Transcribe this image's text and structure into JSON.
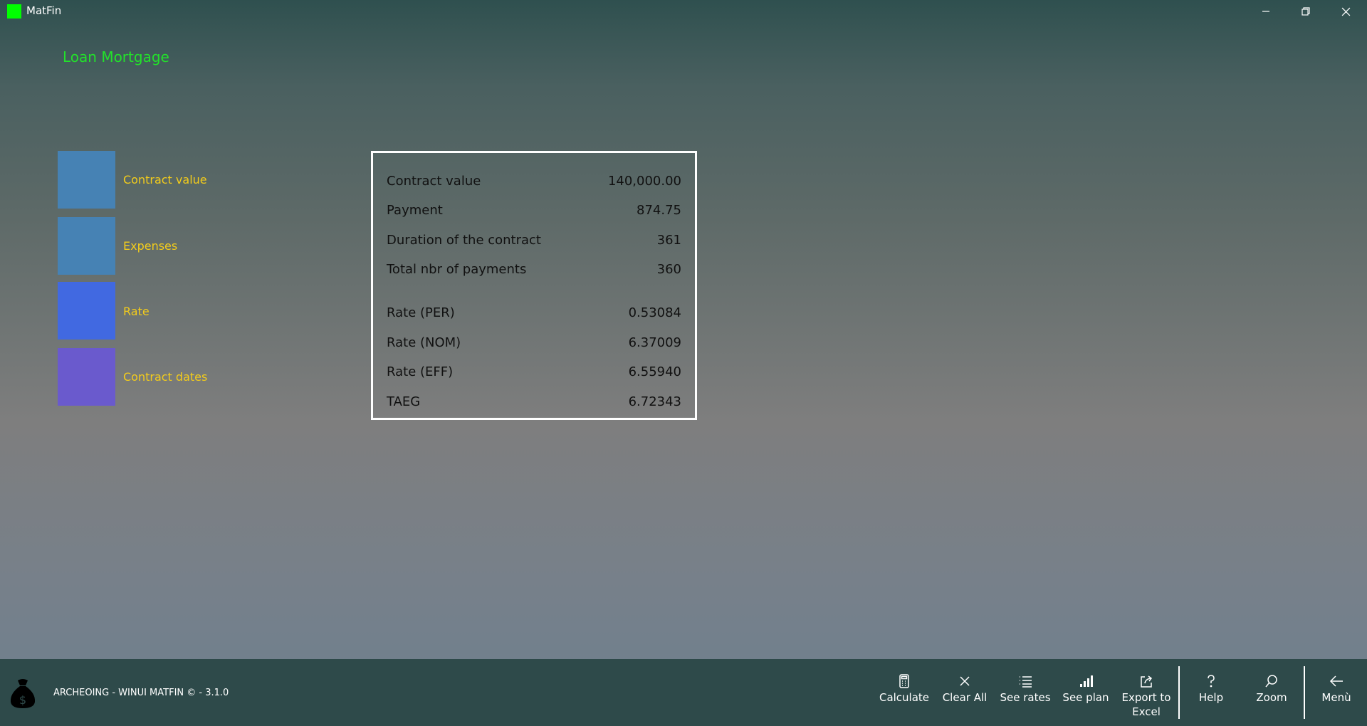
{
  "app": {
    "title": "MatFin",
    "logo_color": "#00ff00"
  },
  "window_controls": {
    "minimize_icon": "minimize-icon",
    "restore_icon": "restore-icon",
    "close_icon": "close-icon"
  },
  "page": {
    "title": "Loan Mortgage",
    "title_color": "#22e22a"
  },
  "tiles": [
    {
      "label": "Contract value",
      "color": "#4682b4"
    },
    {
      "label": "Expenses",
      "color": "#4682b4"
    },
    {
      "label": "Rate",
      "color": "#4169e1"
    },
    {
      "label": "Contract dates",
      "color": "#6a5acd"
    }
  ],
  "results": [
    {
      "label": "Contract value",
      "value": "140,000.00"
    },
    {
      "label": "Payment",
      "value": "874.75"
    },
    {
      "label": "Duration of the contract",
      "value": "361"
    },
    {
      "label": "Total nbr of payments",
      "value": "360"
    },
    {
      "label": "Rate (PER)",
      "value": "0.53084"
    },
    {
      "label": "Rate (NOM)",
      "value": "6.37009"
    },
    {
      "label": "Rate (EFF)",
      "value": "6.55940"
    },
    {
      "label": "TAEG",
      "value": "6.72343"
    }
  ],
  "footer": {
    "text": "ARCHEOING - WINUI MATFIN © - 3.1.0",
    "icon": "money-bag-icon"
  },
  "commands": [
    {
      "label": "Calculate",
      "icon": "calculator-icon"
    },
    {
      "label": "Clear All",
      "icon": "close-icon"
    },
    {
      "label": "See rates",
      "icon": "list-icon"
    },
    {
      "label": "See plan",
      "icon": "bar-chart-icon"
    },
    {
      "label": "Export to Excel",
      "icon": "share-icon"
    },
    {
      "label": "Help",
      "icon": "help-icon"
    },
    {
      "label": "Zoom",
      "icon": "search-icon"
    },
    {
      "label": "Menù",
      "icon": "back-arrow-icon"
    }
  ]
}
